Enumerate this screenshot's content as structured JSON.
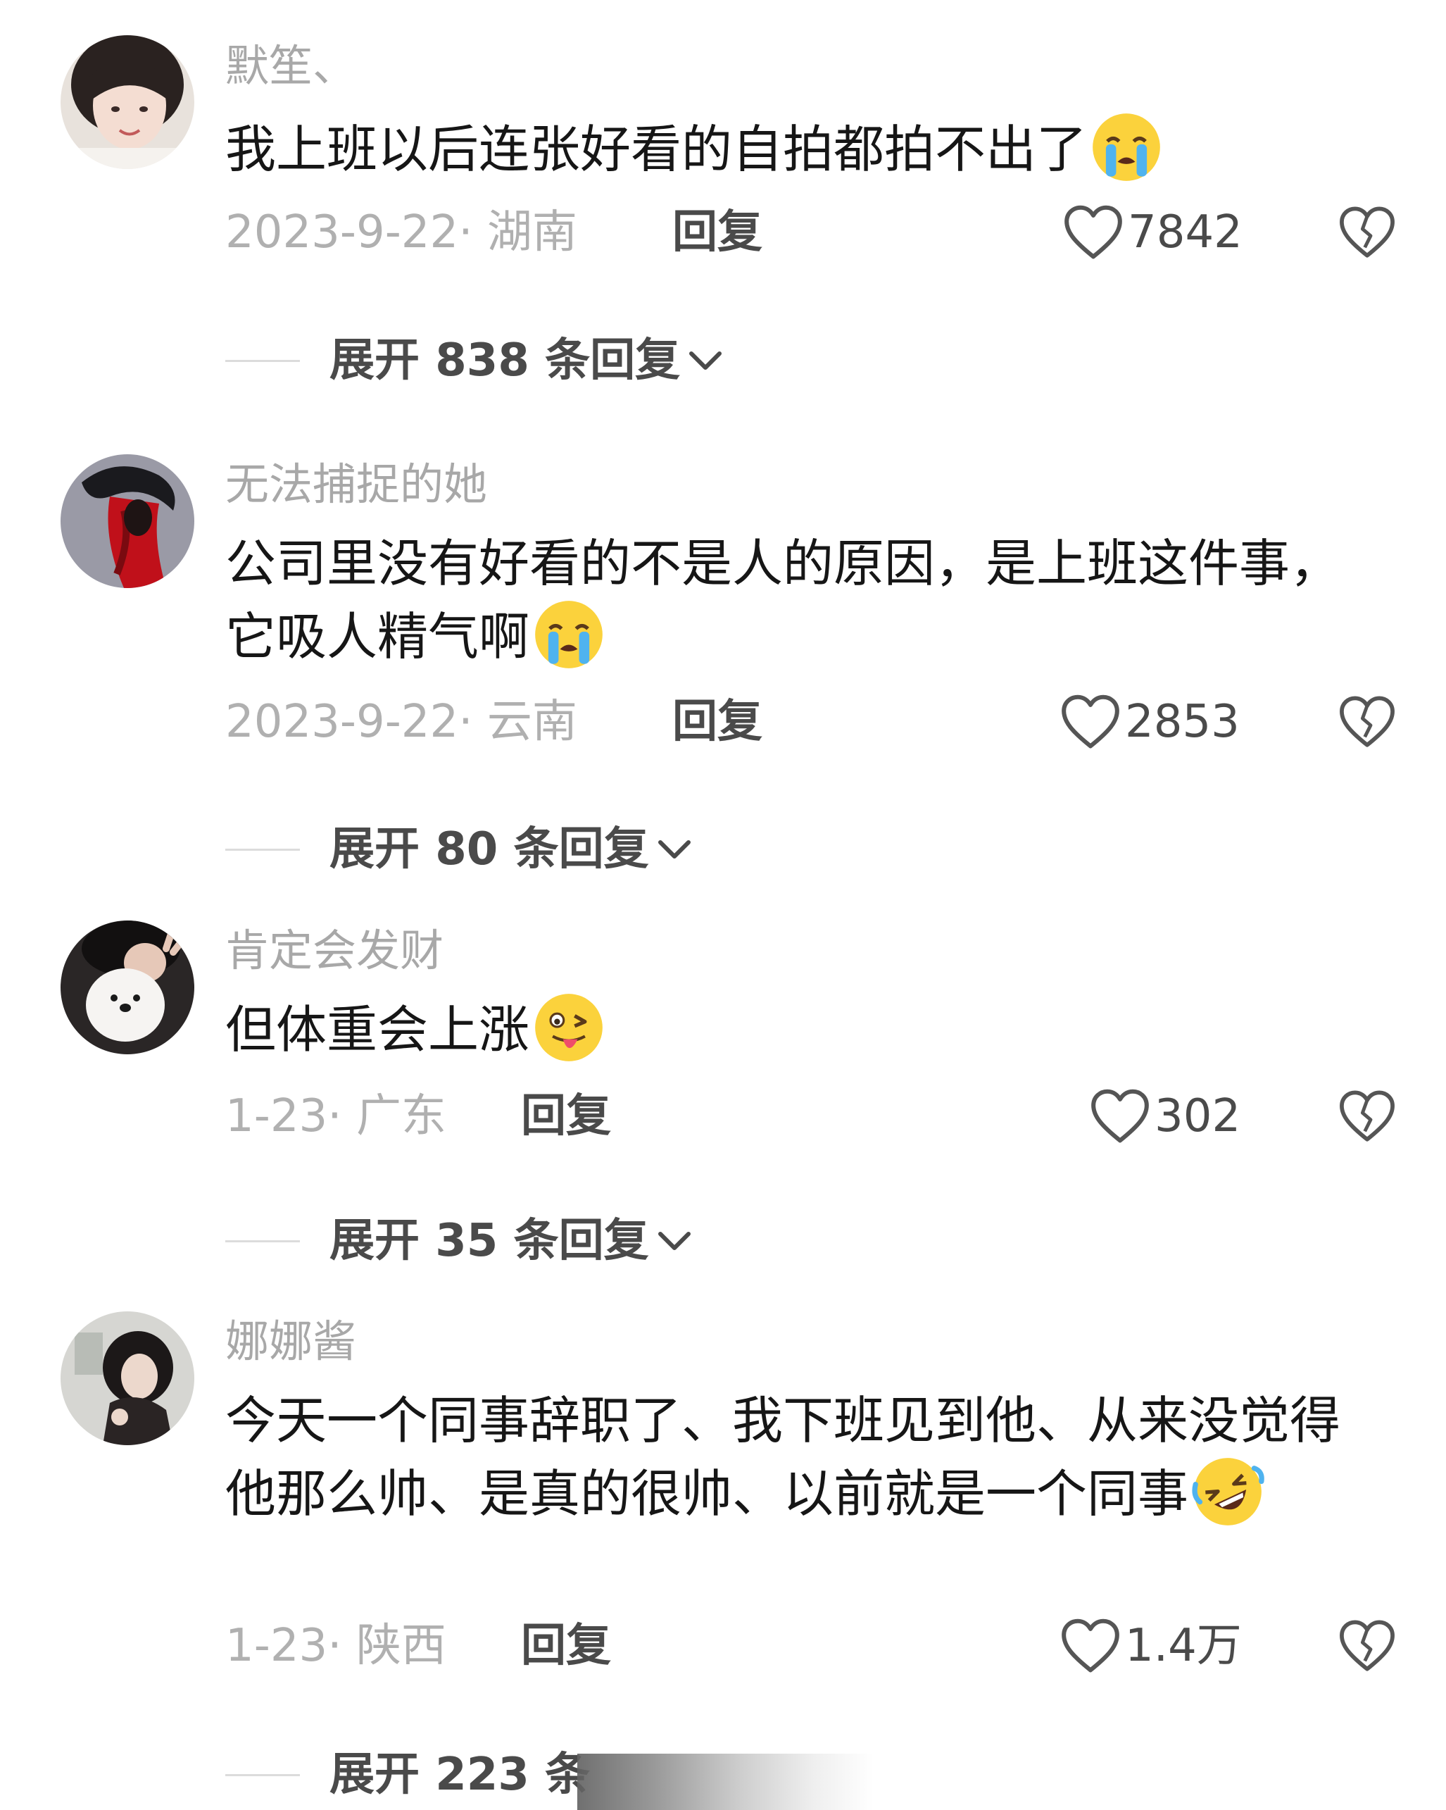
{
  "comments": [
    {
      "username": "默笙、",
      "text": "我上班以后连张好看的自拍都拍不出了",
      "emoji": "loudly-crying-face",
      "date_location": "2023-9-22· 湖南",
      "reply_label": "回复",
      "likes": "7842",
      "expand_label": "展开 838 条回复"
    },
    {
      "username": "无法捕捉的她",
      "text": "公司里没有好看的不是人的原因，是上班这件事，它吸人精气啊",
      "emoji": "loudly-crying-face",
      "date_location": "2023-9-22· 云南",
      "reply_label": "回复",
      "likes": "2853",
      "expand_label": "展开 80 条回复"
    },
    {
      "username": "肯定会发财",
      "text": "但体重会上涨",
      "emoji": "winking-face-with-tongue",
      "date_location": "1-23· 广东",
      "reply_label": "回复",
      "likes": "302",
      "expand_label": "展开 35 条回复"
    },
    {
      "username": "娜娜酱",
      "text": "今天一个同事辞职了、我下班见到他、从来没觉得他那么帅、是真的很帅、以前就是一个同事",
      "emoji": "rolling-on-the-floor-laughing",
      "date_location": "1-23· 陕西",
      "reply_label": "回复",
      "likes": "1.4万",
      "expand_label": "展开 223 条"
    }
  ],
  "icons": {
    "like": "heart-outline-icon",
    "dislike": "broken-heart-icon",
    "expand": "chevron-down-icon"
  },
  "colors": {
    "username": "#a8a8a8",
    "meta": "#b0b0b0",
    "action": "#4a4a4a",
    "text": "#161616"
  }
}
